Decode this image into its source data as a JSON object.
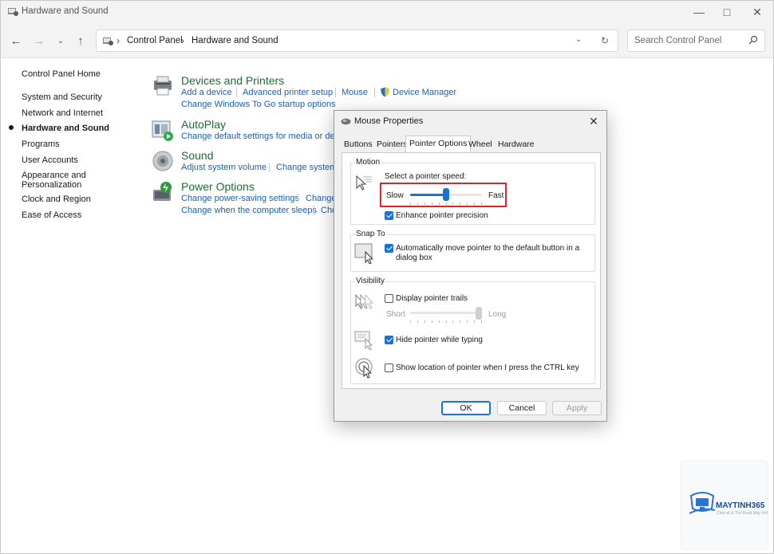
{
  "window": {
    "title": "Hardware and Sound"
  },
  "address": {
    "segments": [
      "Control Panel",
      "Hardware and Sound"
    ]
  },
  "search": {
    "placeholder": "Search Control Panel"
  },
  "sidebar": {
    "items": [
      {
        "label": "Control Panel Home"
      },
      {
        "label": "System and Security"
      },
      {
        "label": "Network and Internet"
      },
      {
        "label": "Hardware and Sound",
        "active": true
      },
      {
        "label": "Programs"
      },
      {
        "label": "User Accounts"
      },
      {
        "label": "Appearance and Personalization"
      },
      {
        "label": "Clock and Region"
      },
      {
        "label": "Ease of Access"
      }
    ]
  },
  "categories": {
    "devices": {
      "title": "Devices and Printers",
      "links": [
        "Add a device",
        "Advanced printer setup",
        "Mouse",
        "Device Manager",
        "Change Windows To Go startup options"
      ]
    },
    "autoplay": {
      "title": "AutoPlay",
      "links": [
        "Change default settings for media or devic"
      ]
    },
    "sound": {
      "title": "Sound",
      "links": [
        "Adjust system volume",
        "Change system s"
      ]
    },
    "power": {
      "title": "Power Options",
      "links": [
        "Change power-saving settings",
        "Change",
        "Change when the computer sleeps",
        "Cho"
      ]
    }
  },
  "dialog": {
    "title": "Mouse Properties",
    "tabs": [
      "Buttons",
      "Pointers",
      "Pointer Options",
      "Wheel",
      "Hardware"
    ],
    "active_tab": "Pointer Options",
    "motion": {
      "label": "Motion",
      "speed_label": "Select a pointer speed:",
      "slow": "Slow",
      "fast": "Fast",
      "speed_value": 0.5,
      "precision_label": "Enhance pointer precision",
      "precision_checked": true
    },
    "snap": {
      "label": "Snap To",
      "auto_label_line1": "Automatically move pointer to the default button in a",
      "auto_label_line2": "dialog box",
      "auto_checked": true
    },
    "visibility": {
      "label": "Visibility",
      "trails_label": "Display pointer trails",
      "trails_checked": false,
      "short": "Short",
      "long": "Long",
      "trails_value": 1.0,
      "hide_label": "Hide pointer while typing",
      "hide_checked": true,
      "ctrl_label": "Show location of pointer when I press the CTRL key",
      "ctrl_checked": false
    },
    "buttons": {
      "ok": "OK",
      "cancel": "Cancel",
      "apply": "Apply"
    }
  },
  "watermark": {
    "text": "MAYTINH365",
    "sub": "Chia sẻ & Thủ thuật Máy tính"
  },
  "colors": {
    "accent": "#1a73d2",
    "link": "#1a5fb4",
    "category_title": "#1e6b34",
    "highlight": "#d9252b"
  }
}
